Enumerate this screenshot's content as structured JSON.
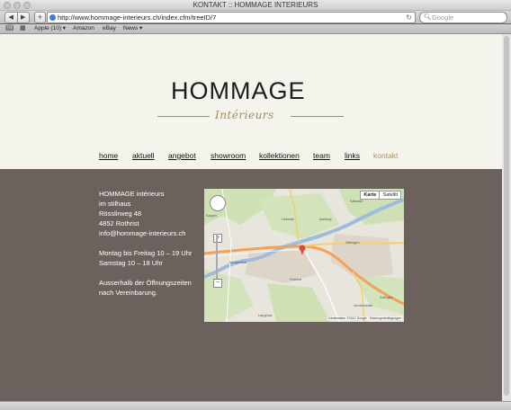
{
  "browser": {
    "window_title": "KONTAKT :: HOMMAGE INTERIEURS",
    "url": "http://www.hommage-interieurs.ch/index.cfm/treeID/7",
    "search_placeholder": "Google",
    "bookmarks": [
      "Apple (10) ▾",
      "Amazon",
      "eBay",
      "News ▾"
    ]
  },
  "site": {
    "logo": "HOMMAGE",
    "tagline": "Intérieurs",
    "nav": [
      "home",
      "aktuell",
      "angebot",
      "showroom",
      "kollektionen",
      "team",
      "links",
      "kontakt"
    ],
    "active_nav": "kontakt",
    "accent_color": "#b0936a"
  },
  "contact": {
    "address": [
      "HOMMAGE intérieurs",
      "im stilhaus",
      "Rösslirweg 48",
      "4852 Rothrist",
      "info@hommage-interieurs.ch"
    ],
    "hours": [
      "Montag bis Freitag 10 – 19 Uhr",
      "Samstag 10 – 18 Uhr"
    ],
    "note": [
      "Ausserhalb der Öffnungszeiten",
      "nach Vereinbarung."
    ]
  },
  "map": {
    "type_buttons": [
      "Karte",
      "Satellit"
    ],
    "labels": [
      "Kappel",
      "Hofwald",
      "Aarburg",
      "Säliwald",
      "Oftringen",
      "Rothrist",
      "Zofingen",
      "Langholz",
      "Murgenthal",
      "Vordemwald"
    ],
    "footer": "Kartendaten ©2012 Google · Nutzungsbedingungen"
  }
}
